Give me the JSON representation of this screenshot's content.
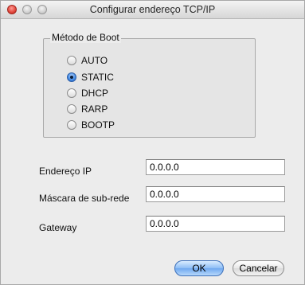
{
  "window": {
    "title": "Configurar endereço TCP/IP"
  },
  "boot_method": {
    "label": "Método de Boot",
    "selected": "STATIC",
    "options": [
      {
        "label": "AUTO",
        "checked": false
      },
      {
        "label": "STATIC",
        "checked": true
      },
      {
        "label": "DHCP",
        "checked": false
      },
      {
        "label": "RARP",
        "checked": false
      },
      {
        "label": "BOOTP",
        "checked": false
      }
    ]
  },
  "fields": {
    "ip": {
      "label": "Endereço IP",
      "value": "0.0.0.0"
    },
    "mask": {
      "label": "Máscara de sub-rede",
      "value": "0.0.0.0"
    },
    "gateway": {
      "label": "Gateway",
      "value": "0.0.0.0"
    }
  },
  "buttons": {
    "ok": "OK",
    "cancel": "Cancelar"
  }
}
